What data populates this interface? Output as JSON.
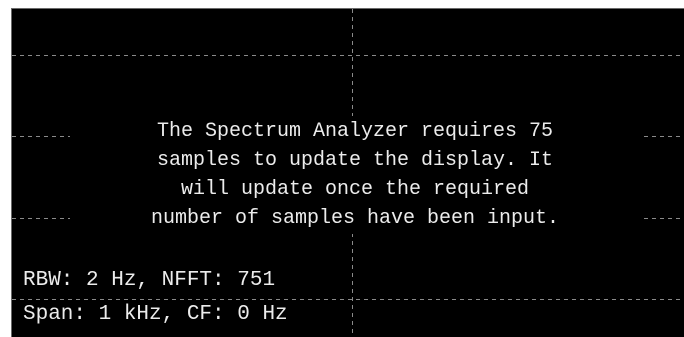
{
  "message": {
    "lines": [
      "The Spectrum Analyzer requires 75",
      "samples to update the display. It",
      "will update once the required",
      "number of samples have been input."
    ]
  },
  "readouts": {
    "rbw_nfft": "RBW: 2 Hz, NFFT: 751",
    "span_cf": "Span: 1 kHz, CF: 0 Hz"
  },
  "colors": {
    "background": "#000000",
    "text": "#ececec",
    "grid": "#8a8a8a"
  }
}
